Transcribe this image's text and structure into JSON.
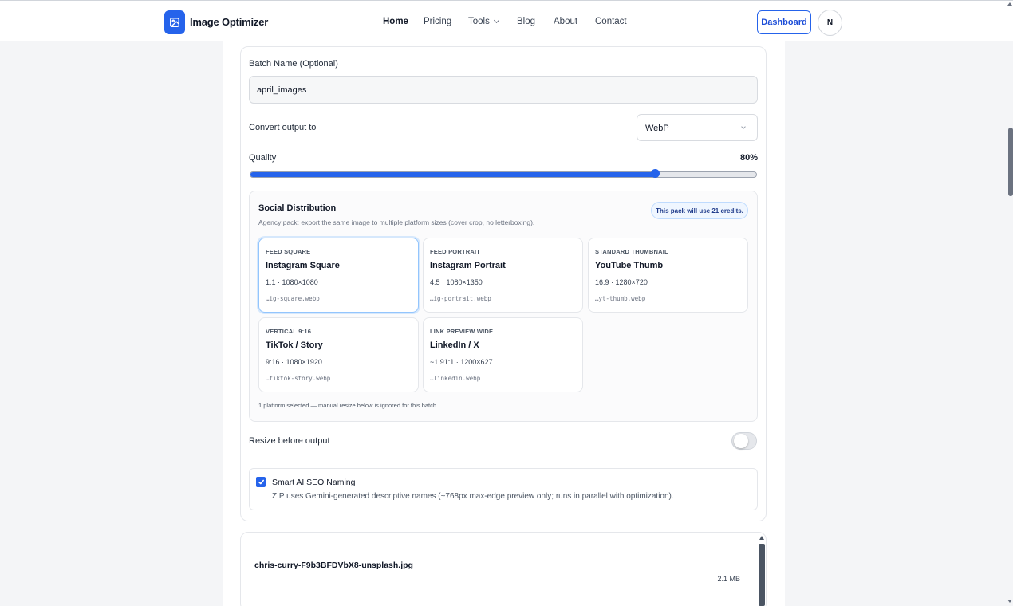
{
  "header": {
    "brand": "Image Optimizer",
    "logo_icon": "image-icon",
    "nav": [
      {
        "label": "Home",
        "active": true
      },
      {
        "label": "Pricing"
      },
      {
        "label": "Tools",
        "has_dropdown": true
      },
      {
        "label": "Blog"
      },
      {
        "label": "About"
      },
      {
        "label": "Contact"
      }
    ],
    "dashboard_label": "Dashboard",
    "avatar_initial": "N"
  },
  "settings": {
    "batch_name_label": "Batch Name (Optional)",
    "batch_name_value": "april_images",
    "convert_label": "Convert output to",
    "convert_value": "WebP",
    "quality_label": "Quality",
    "quality_display": "80%",
    "quality_value": 80,
    "resize_label": "Resize before output",
    "resize_enabled": false
  },
  "social": {
    "title": "Social Distribution",
    "subtitle": "Agency pack: export the same image to multiple platform sizes (cover crop, no letterboxing).",
    "credits_badge": "This pack will use 21 credits.",
    "cards": [
      {
        "kind": "FEED SQUARE",
        "name": "Instagram Square",
        "ratio": "1:1",
        "size": "1080×1080",
        "file": "…ig-square.webp",
        "selected": true
      },
      {
        "kind": "FEED PORTRAIT",
        "name": "Instagram Portrait",
        "ratio": "4:5",
        "size": "1080×1350",
        "file": "…ig-portrait.webp",
        "selected": false
      },
      {
        "kind": "STANDARD THUMBNAIL",
        "name": "YouTube Thumb",
        "ratio": "16:9",
        "size": "1280×720",
        "file": "…yt-thumb.webp",
        "selected": false
      },
      {
        "kind": "VERTICAL 9:16",
        "name": "TikTok / Story",
        "ratio": "9:16",
        "size": "1080×1920",
        "file": "…tiktok-story.webp",
        "selected": false
      },
      {
        "kind": "LINK PREVIEW WIDE",
        "name": "LinkedIn / X",
        "ratio": "~1.91:1",
        "size": "1200×627",
        "file": "…linkedin.webp",
        "selected": false
      }
    ],
    "note": "1 platform selected — manual resize below is ignored for this batch."
  },
  "ai_naming": {
    "checked": true,
    "title": "Smart AI SEO Naming",
    "description": "ZIP uses Gemini-generated descriptive names (~768px max-edge preview only; runs in parallel with optimization)."
  },
  "file": {
    "name": "chris-curry-F9b3BFDVbX8-unsplash.jpg",
    "size": "2.1 MB"
  },
  "colors": {
    "accent": "#2563eb",
    "badge_bg": "#eff6ff",
    "card_selected_border": "#93c5fd"
  }
}
